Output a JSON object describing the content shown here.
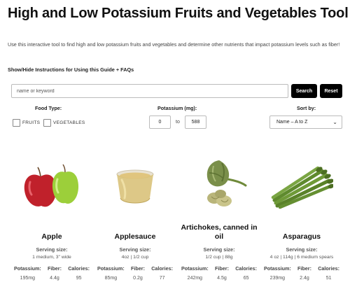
{
  "header": {
    "title": "High and Low Potassium Fruits and Vegetables Tool",
    "intro": "Use this interactive tool to find high and low potassium fruits and vegetables and determine other nutrients that impact potassium levels such as fiber!",
    "instructions_link": "Show/Hide Instructions for Using this Guide + FAQs"
  },
  "search": {
    "placeholder": "name or keyword",
    "value": "",
    "search_label": "Search",
    "reset_label": "Reset"
  },
  "filters": {
    "food_type_label": "Food Type:",
    "fruits_label": "FRUITS",
    "vegetables_label": "VEGETABLES",
    "potassium_label": "Potassium (mg):",
    "min": "0",
    "to": "to",
    "max": "588",
    "sort_label": "Sort by:",
    "sort_value": "Name – A to Z"
  },
  "foods": [
    {
      "name": "Apple",
      "serving_label": "Serving size:",
      "serving": "1 medium, 3\" wide",
      "potassium_label": "Potassium:",
      "potassium": "195mg",
      "fiber_label": "Fiber:",
      "fiber": "4.4g",
      "calories_label": "Calories:",
      "calories": "95"
    },
    {
      "name": "Applesauce",
      "serving_label": "Serving size:",
      "serving": "4oz | 1/2 cup",
      "potassium_label": "Potassium:",
      "potassium": "85mg",
      "fiber_label": "Fiber:",
      "fiber": "0.2g",
      "calories_label": "Calories:",
      "calories": "77"
    },
    {
      "name": "Artichokes, canned in oil",
      "serving_label": "Serving size:",
      "serving": "1/2 cup | 88g",
      "potassium_label": "Potassium:",
      "potassium": "242mg",
      "fiber_label": "Fiber:",
      "fiber": "4.5g",
      "calories_label": "Calories:",
      "calories": "65"
    },
    {
      "name": "Asparagus",
      "serving_label": "Serving size:",
      "serving": "4 oz | 114g | 6 medium spears",
      "potassium_label": "Potassium:",
      "potassium": "239mg",
      "fiber_label": "Fiber:",
      "fiber": "2.4g",
      "calories_label": "Calories:",
      "calories": "51"
    }
  ],
  "colors": {
    "button_bg": "#000000",
    "apple_red": "#c0212b",
    "apple_green": "#9ccf3a",
    "applesauce": "#d9c27a",
    "artichoke": "#7a8f4a",
    "asparagus": "#5f8a2e"
  }
}
